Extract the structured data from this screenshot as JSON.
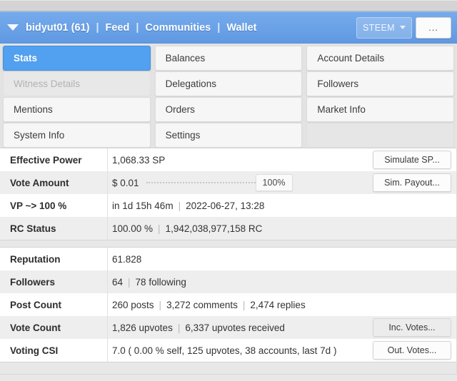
{
  "header": {
    "caret_icon": "chevron-down-icon",
    "account": "bidyut01 (61)",
    "sep": "|",
    "links": [
      "Feed",
      "Communities",
      "Wallet"
    ],
    "chain_label": "STEEM",
    "chain_caret_icon": "caret-down-icon",
    "more_label": "...",
    "accent_color": "#6ba3e8"
  },
  "tabs": {
    "items": [
      {
        "label": "Stats",
        "state": "active"
      },
      {
        "label": "Balances",
        "state": "normal"
      },
      {
        "label": "Account Details",
        "state": "normal"
      },
      {
        "label": "Witness Details",
        "state": "disabled"
      },
      {
        "label": "Delegations",
        "state": "normal"
      },
      {
        "label": "Followers",
        "state": "normal"
      },
      {
        "label": "Mentions",
        "state": "normal"
      },
      {
        "label": "Orders",
        "state": "normal"
      },
      {
        "label": "Market Info",
        "state": "normal"
      },
      {
        "label": "System Info",
        "state": "normal"
      },
      {
        "label": "Settings",
        "state": "normal"
      },
      {
        "label": "",
        "state": "empty"
      }
    ],
    "active_color": "#52a0f0"
  },
  "stats": {
    "section_one": [
      {
        "label": "Effective Power",
        "values": [
          "1,068.33 SP"
        ],
        "action": {
          "label": "Simulate SP...",
          "hover": false
        }
      },
      {
        "label": "Vote Amount",
        "values": [
          "$ 0.01"
        ],
        "slider": {
          "percent_label": "100%",
          "percent": 100
        },
        "action": {
          "label": "Sim. Payout...",
          "hover": false
        }
      },
      {
        "label": "VP ~> 100 %",
        "values": [
          "in 1d 15h 46m",
          "2022-06-27, 13:28"
        ],
        "action": null
      },
      {
        "label": "RC Status",
        "values": [
          "100.00 %",
          "1,942,038,977,158 RC"
        ],
        "action": null
      }
    ],
    "section_two": [
      {
        "label": "Reputation",
        "values": [
          "61.828"
        ],
        "action": null
      },
      {
        "label": "Followers",
        "values": [
          "64",
          "78 following"
        ],
        "action": null
      },
      {
        "label": "Post Count",
        "values": [
          "260 posts",
          "3,272 comments",
          "2,474 replies"
        ],
        "action": null
      },
      {
        "label": "Vote Count",
        "values": [
          "1,826 upvotes",
          "6,337 upvotes received"
        ],
        "action": {
          "label": "Inc. Votes...",
          "hover": true
        }
      },
      {
        "label": "Voting CSI",
        "values": [
          "7.0 ( 0.00 % self, 125 upvotes, 38 accounts, last 7d )"
        ],
        "action": {
          "label": "Out. Votes...",
          "hover": false
        }
      }
    ]
  }
}
